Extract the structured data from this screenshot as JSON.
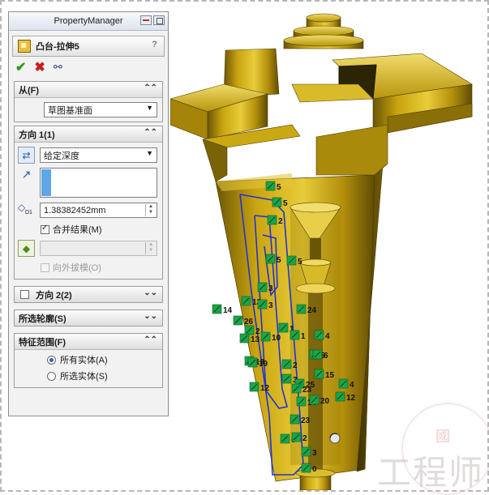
{
  "property_manager": {
    "title": "PropertyManager",
    "feature_name": "凸台-拉伸5",
    "help": "?",
    "from": {
      "header": "从(F)",
      "start_condition": "草图基准面"
    },
    "direction1": {
      "header": "方向 1(1)",
      "end_condition": "给定深度",
      "depth": "1.38382452mm",
      "depth_label": "D1",
      "merge_result_label": "合并结果(M)",
      "merge_result_checked": true,
      "draft_outward_label": "向外拔模(O)"
    },
    "direction2": {
      "header": "方向 2(2)"
    },
    "selected_contours": {
      "header": "所选轮廓(S)"
    },
    "feature_scope": {
      "header": "特征范围(F)",
      "options": [
        "所有实体(A)",
        "所选实体(S)"
      ],
      "selected": "所有实体(A)"
    }
  },
  "viewport": {
    "dimension_tags": [
      "5",
      "5",
      "2",
      "5",
      "5",
      "3",
      "14",
      "13",
      "26",
      "3",
      "1",
      "2",
      "13",
      "10",
      "1",
      "13",
      "2",
      "5",
      "19",
      "3",
      "25",
      "12",
      "4",
      "23",
      "14",
      "20",
      "4",
      "12",
      "23",
      "0",
      "2",
      "3",
      "0",
      "24",
      "6",
      "15"
    ]
  },
  "watermark": {
    "text": "工程师",
    "small": "國"
  },
  "colors": {
    "model_gold": "#c9a40f",
    "model_shadow": "#5a4a05",
    "sketch_blue": "#1f33d6",
    "relation_green": "#1aa64a"
  }
}
